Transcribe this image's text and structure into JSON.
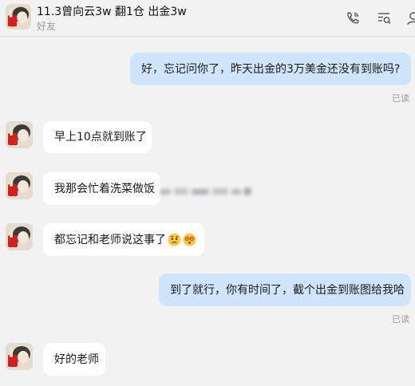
{
  "header": {
    "title": "11.3曾向云3w 翻1仓 出金3w",
    "subtitle": "好友"
  },
  "icons": {
    "call": "phone-icon",
    "search": "search-list-icon",
    "profile": "person-icon"
  },
  "colors": {
    "outgoing_bubble": "#cfe5fb",
    "incoming_bubble": "#ffffff",
    "background": "#f2f2f3",
    "read_status": "#9a9aa0"
  },
  "messages": [
    {
      "direction": "out",
      "text": "好，忘记问你了，昨天出金的3万美金还没有到账吗?",
      "status": "已读"
    },
    {
      "direction": "in",
      "text": "早上10点就到账了"
    },
    {
      "direction": "in",
      "text": "我那会忙着洗菜做饭"
    },
    {
      "direction": "in",
      "text": "都忘记和老师说这事了"
    },
    {
      "direction": "out",
      "text": "到了就行，你有时间了，截个出金到账图给我哈",
      "status": "已读"
    },
    {
      "direction": "in",
      "text": "好的老师"
    }
  ]
}
